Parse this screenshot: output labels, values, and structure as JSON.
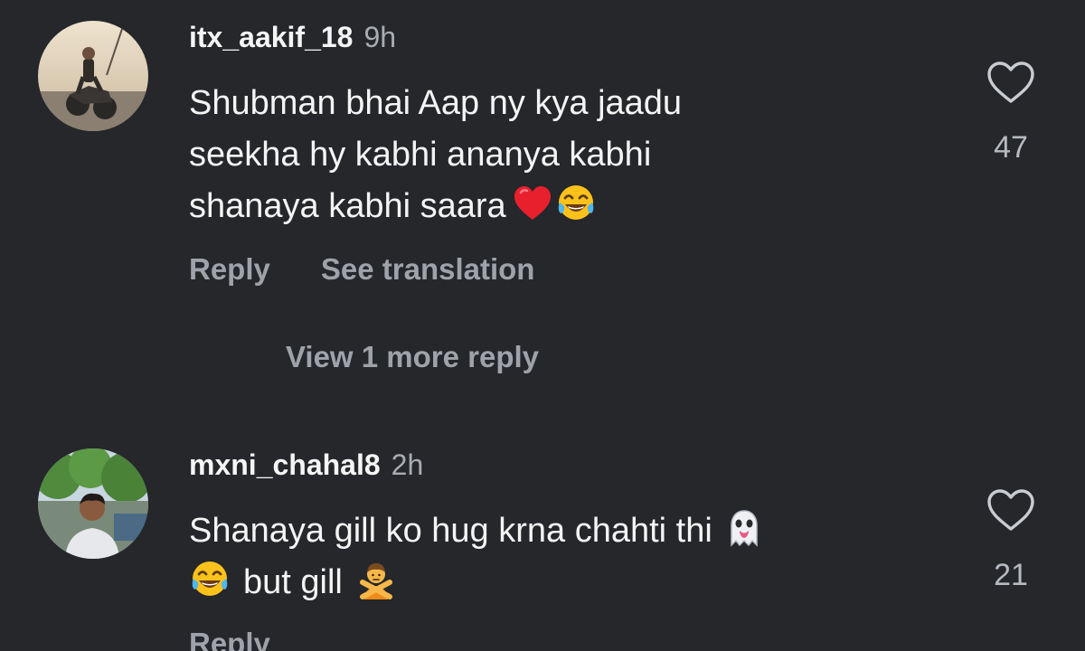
{
  "comments": [
    {
      "username": "itx_aakif_18",
      "timestamp": "9h",
      "text_lines": [
        "Shubman bhai Aap ny kya jaadu",
        "seekha hy kabhi ananya kabhi",
        "shanaya kabhi saara"
      ],
      "emojis": [
        "red-heart-emoji",
        "tears-of-joy-emoji"
      ],
      "likes": "47",
      "reply_label": "Reply",
      "translate_label": "See translation",
      "view_replies_label": "View 1 more reply"
    },
    {
      "username": "mxni_chahal8",
      "timestamp": "2h",
      "text_lines": [
        "Shanaya gill ko hug krna chahti thi",
        "but gill"
      ],
      "emojis": [
        "ghost-emoji",
        "tears-of-joy-emoji",
        "person-gesturing-no-emoji"
      ],
      "likes": "21",
      "reply_label": "Reply"
    }
  ],
  "colors": {
    "background": "#25272b",
    "primary_text": "#f4f4f4",
    "secondary_text": "#9fa3a9",
    "heart_emoji": "#e8202e"
  },
  "icons": {
    "like": "heart-outline-icon"
  }
}
